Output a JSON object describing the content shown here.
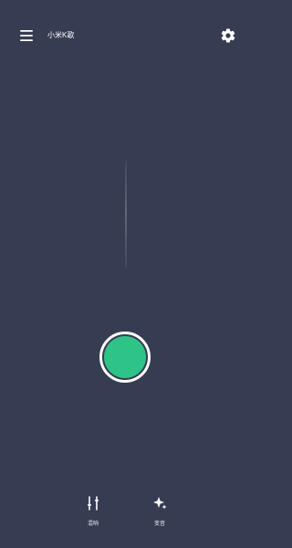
{
  "app": {
    "title": "小米K歌",
    "background_color": "#363c52",
    "accent_color": "#2fc487"
  },
  "header": {
    "menu_icon": "hamburger-menu-icon",
    "settings_icon": "gear-icon"
  },
  "recorder": {
    "record_button_icon": "record-button-icon"
  },
  "bottom_actions": [
    {
      "label": "混响",
      "icon": "equalizer-sliders-icon"
    },
    {
      "label": "变音",
      "icon": "sparkle-effects-icon"
    }
  ]
}
